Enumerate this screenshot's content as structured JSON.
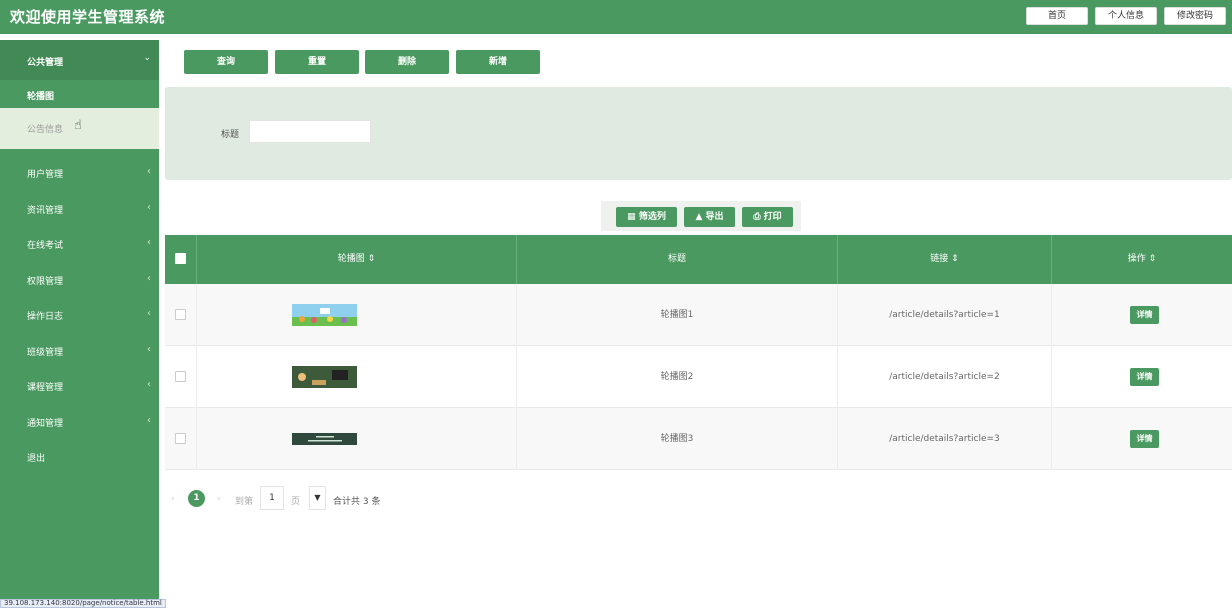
{
  "header": {
    "title": "欢迎使用学生管理系统",
    "buttons": [
      "首页",
      "个人信息",
      "修改密码"
    ]
  },
  "sidebar": {
    "group": "公共管理",
    "sub_active": "轮播图",
    "sub_item": "公告信息",
    "items": [
      "用户管理",
      "资讯管理",
      "在线考试",
      "权限管理",
      "操作日志",
      "班级管理",
      "课程管理",
      "通知管理",
      "退出"
    ]
  },
  "actions": [
    "查询",
    "重置",
    "删除",
    "新增"
  ],
  "search": {
    "label": "标题",
    "value": ""
  },
  "toolbar": {
    "filter": "筛选列",
    "export": "导出",
    "print": "打印"
  },
  "table": {
    "headers": [
      "轮播图",
      "标题",
      "链接",
      "操作"
    ],
    "rows": [
      {
        "title": "轮播图1",
        "link": "/article/details?article=1",
        "action": "详情"
      },
      {
        "title": "轮播图2",
        "link": "/article/details?article=2",
        "action": "详情"
      },
      {
        "title": "轮播图3",
        "link": "/article/details?article=3",
        "action": "详情"
      }
    ]
  },
  "pagination": {
    "current": "1",
    "goto": "到第",
    "page_value": "1",
    "page_unit": "页",
    "total": "合计共 3 条"
  },
  "status_url": "39.108.173.140:8020/page/notice/table.html",
  "colors": {
    "primary": "#4a9960",
    "panel": "#dfebe1"
  }
}
